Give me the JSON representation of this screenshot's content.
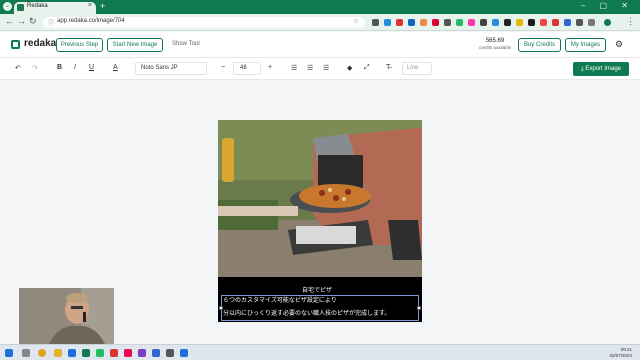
{
  "browser": {
    "tab_title": "Redaka",
    "tab_close": "×",
    "new_tab": "+",
    "url": "app.redaka.co/image/704",
    "window_controls": "–  ▢  ✕"
  },
  "header": {
    "logo": "redaka",
    "previous_step": "Previous Step",
    "start_new_image": "Start New Image",
    "show_tour": "Show Tour",
    "credits_value": "565.69",
    "credits_label": "credits available",
    "buy_credits": "Buy Credits",
    "my_images": "My Images"
  },
  "toolbar": {
    "undo": "↶",
    "redo": "↷",
    "bold": "B",
    "italic": "I",
    "underline": "U",
    "text_color": "A",
    "font_family": "Noto Sans JP",
    "decrease": "−",
    "font_size": "48",
    "increase": "+",
    "line_placeholder": "Line",
    "export": "Export Image"
  },
  "canvas": {
    "caption_title": "自宅でピザ",
    "caption_line1": "６つのカスタマイズ可能なピザ設定により",
    "caption_line2": "分以内にひっくり返す必要のない職人技のピザが完成します。"
  },
  "taskbar": {
    "time": "09:21",
    "date": "02/07/2024"
  },
  "colors": {
    "brand": "#0f7a52",
    "chrome": "#0f7a52"
  }
}
